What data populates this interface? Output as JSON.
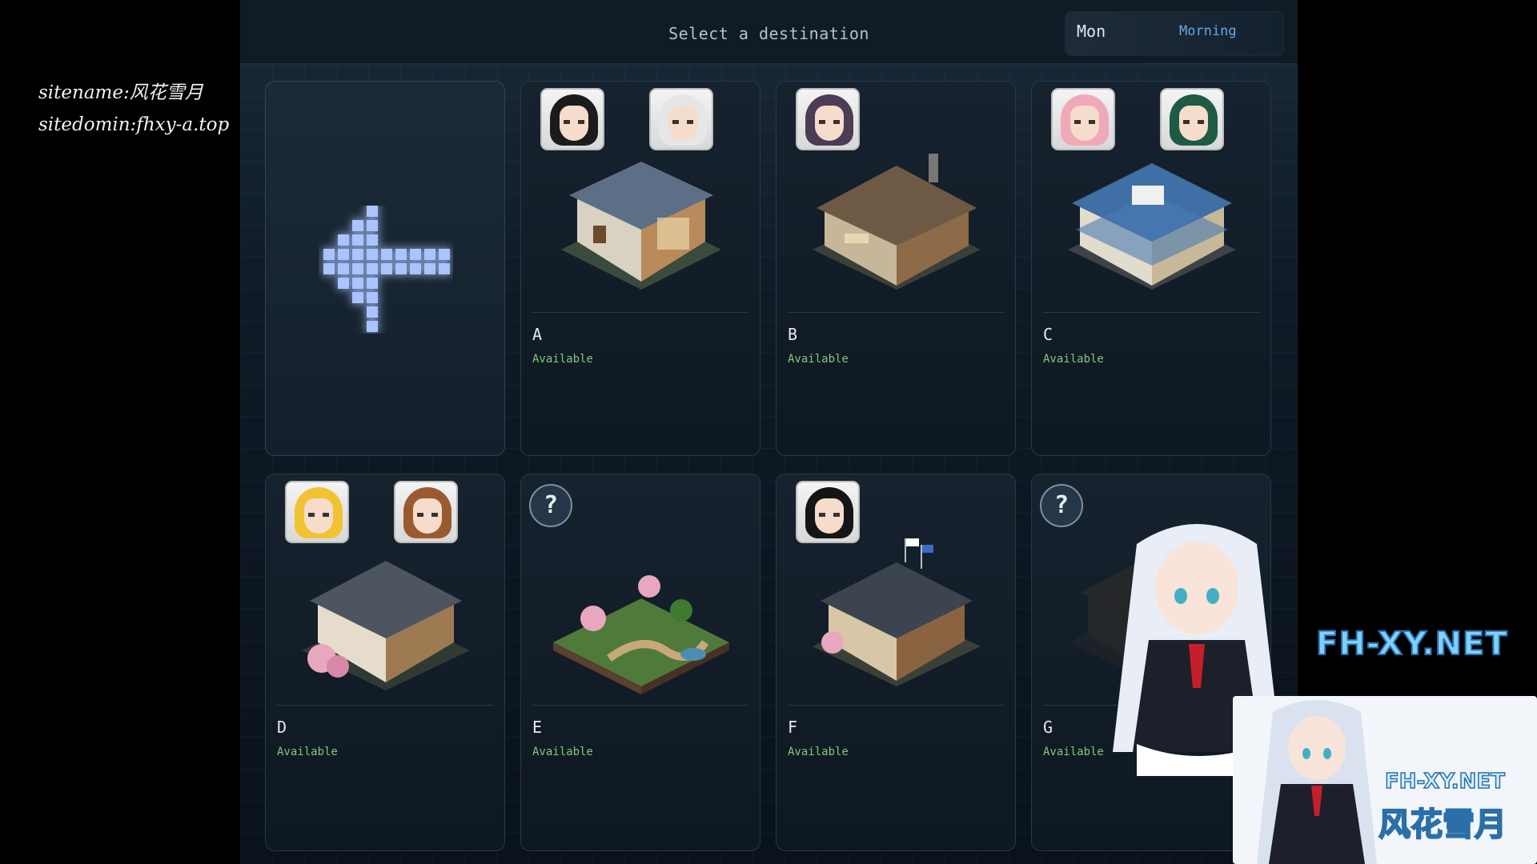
{
  "watermark": {
    "line1": "sitename:风花雪月",
    "line2": "sitedomin:fhxy-a.top"
  },
  "header": {
    "title": "Select a destination",
    "day": "Mon",
    "time_of_day": "Morning"
  },
  "back": {
    "icon": "back-arrow-icon"
  },
  "locations": [
    {
      "name": "A",
      "status": "Available"
    },
    {
      "name": "B",
      "status": "Available"
    },
    {
      "name": "C",
      "status": "Available"
    },
    {
      "name": "D",
      "status": "Available"
    },
    {
      "name": "E",
      "status": "Available",
      "unknown_marker": "?"
    },
    {
      "name": "F",
      "status": "Available"
    },
    {
      "name": "G",
      "status": "Available",
      "unknown_marker": "?"
    }
  ],
  "corner_watermark": {
    "text1": "FH-XY.NET",
    "text2": "FH-XY.NET",
    "text3": "风花雪月"
  },
  "colors": {
    "status_available": "#7fc97a",
    "time_accent": "#6aa8e6"
  }
}
